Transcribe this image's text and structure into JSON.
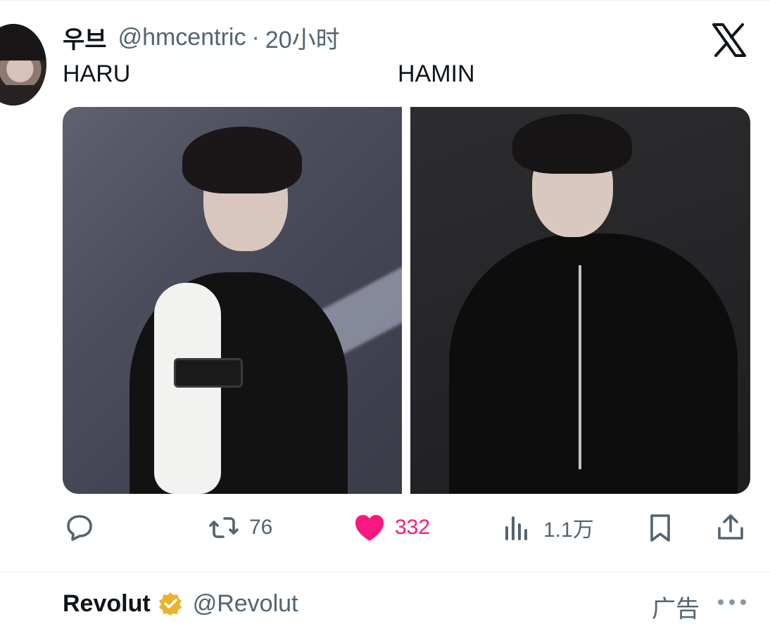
{
  "tweet": {
    "author_name": "우브",
    "author_handle": "@hmcentric",
    "separator": "·",
    "time_ago": "20小时",
    "caption_left": "HARU",
    "caption_right": "HAMIN",
    "actions": {
      "reply_icon": "reply-icon",
      "retweet_count": "76",
      "like_count": "332",
      "views_count": "1.1万"
    }
  },
  "brand": {
    "logo_icon": "x-logo-icon"
  },
  "colors": {
    "primary_text": "#0f1419",
    "secondary_text": "#536471",
    "like_active": "#f91880",
    "divider": "#eff3f4"
  },
  "next_tweet": {
    "author_name": "Revolut",
    "author_handle": "@Revolut",
    "ad_label": "广告",
    "verified_icon": "verified-badge-icon",
    "more_icon": "more-icon"
  }
}
